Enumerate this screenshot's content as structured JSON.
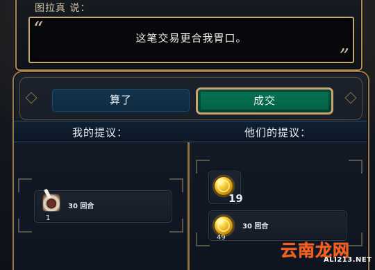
{
  "dialog": {
    "speaker": "图拉真 说：",
    "quote": "这笔交易更合我胃口。",
    "open_mark": "“",
    "close_mark": "”"
  },
  "trade": {
    "buttons": {
      "cancel": "算了",
      "accept": "成交"
    },
    "labels": {
      "mine": "我的提议：",
      "theirs": "他们的提议："
    },
    "my_offer": {
      "icon": "food-bowl-icon",
      "label": "30 回合",
      "quantity": "1"
    },
    "their_offer": {
      "gold_icon": "gold-coin-icon",
      "gold_amount": "19",
      "gold_per_turn_icon": "gold-coin-icon",
      "gold_per_turn_label": "30 回合",
      "gold_per_turn_amount": "49"
    }
  },
  "watermark": {
    "cn": "云南龙网",
    "en": "ALI213.NET"
  },
  "colors": {
    "gold_border": "#b08b52",
    "accept_green": "#067456",
    "cancel_blue": "#13344c",
    "watermark_orange": "#ff5a16"
  }
}
